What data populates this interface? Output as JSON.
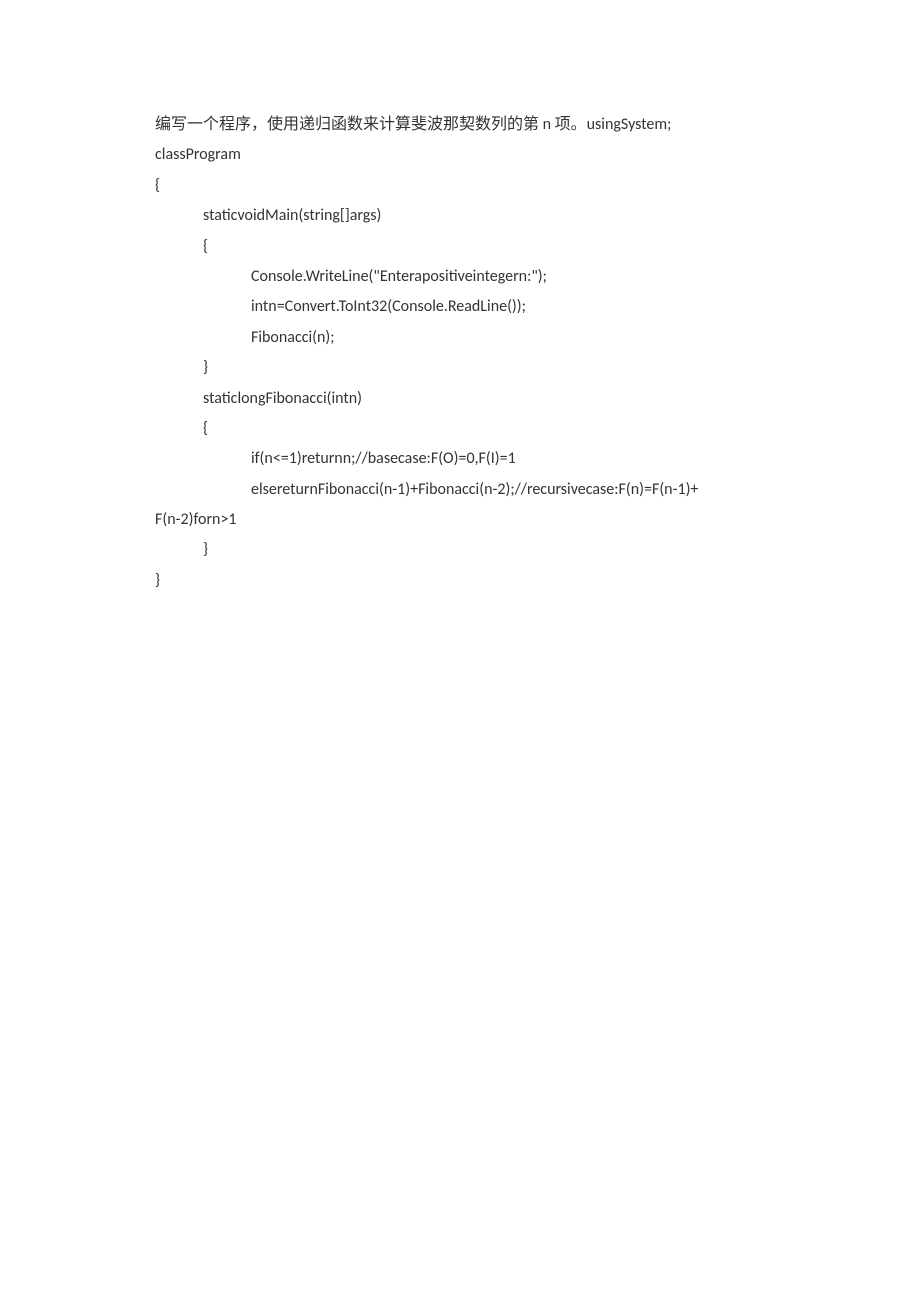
{
  "document": {
    "lines": [
      {
        "text": "编写一个程序，使用递归函数来计算斐波那契数列的第 n 项。usingSystem;",
        "cls": "line"
      },
      {
        "text": "",
        "cls": "blank-line"
      },
      {
        "text": "classProgram",
        "cls": "line"
      },
      {
        "text": "{",
        "cls": "line"
      },
      {
        "text": "staticvoidMain(string[]args)",
        "cls": "line indent-1"
      },
      {
        "text": "{",
        "cls": "line indent-1"
      },
      {
        "text": "Console.WriteLine(\"Enterapositiveintegern:\");",
        "cls": "line indent-2"
      },
      {
        "text": "intn=Convert.ToInt32(Console.ReadLine());",
        "cls": "line indent-2"
      },
      {
        "text": "Fibonacci(n);",
        "cls": "line indent-2"
      },
      {
        "text": "}",
        "cls": "line indent-1"
      },
      {
        "text": "",
        "cls": "blank-line"
      },
      {
        "text": "staticlongFibonacci(intn)",
        "cls": "line indent-1"
      },
      {
        "text": "{",
        "cls": "line indent-1"
      },
      {
        "text": "if(n<=1)returnn;//basecase:F(O)=0,F(I)=1",
        "cls": "line indent-2"
      },
      {
        "text": "elsereturnFibonacci(n-1)+Fibonacci(n-2);//recursivecase:F(n)=F(n-1)+",
        "cls": "line indent-2"
      },
      {
        "text": "F(n-2)forn>1",
        "cls": "line wrapped"
      },
      {
        "text": "}",
        "cls": "line indent-1"
      },
      {
        "text": "}",
        "cls": "line"
      }
    ]
  }
}
